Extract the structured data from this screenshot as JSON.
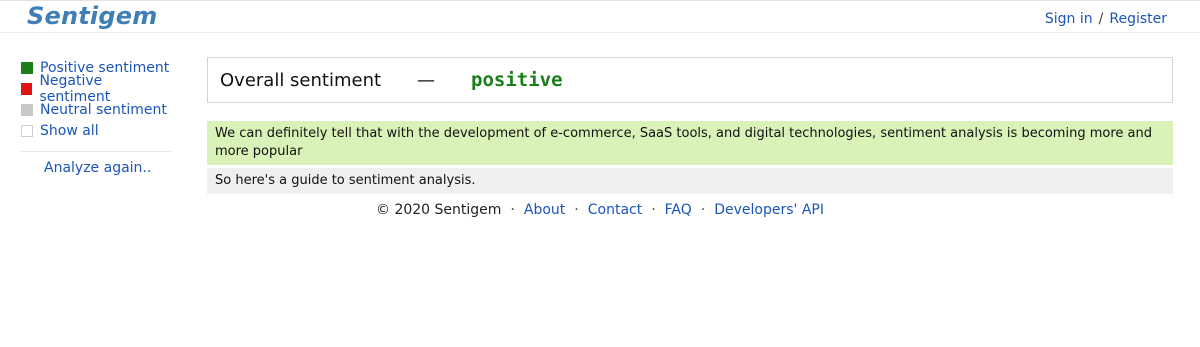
{
  "header": {
    "logo": "Sentigem",
    "sign_in": "Sign in",
    "separator": "/",
    "register": "Register"
  },
  "sidebar": {
    "legend": [
      {
        "label": "Positive sentiment",
        "color": "#1a7f1a"
      },
      {
        "label": "Negative sentiment",
        "color": "#e01414"
      },
      {
        "label": "Neutral sentiment",
        "color": "#c8c8c8"
      },
      {
        "label": "Show all",
        "color": "#ffffff"
      }
    ],
    "analyze_again": "Analyze again.."
  },
  "result": {
    "overall_label": "Overall sentiment",
    "dash": "—",
    "verdict": "positive",
    "verdict_color": "#1a7f1a",
    "sentences": [
      {
        "text": "We can definitely tell that with the development of e-commerce, SaaS tools, and digital technologies, sentiment analysis is becoming more and more popular",
        "sentiment": "positive",
        "color": "#d9f2b8"
      },
      {
        "text": "So here's a guide to sentiment analysis.",
        "sentiment": "neutral",
        "color": "#efefef"
      }
    ]
  },
  "footer": {
    "copyright": "© 2020 Sentigem",
    "dot": "·",
    "links": [
      "About",
      "Contact",
      "FAQ",
      "Developers' API"
    ]
  }
}
